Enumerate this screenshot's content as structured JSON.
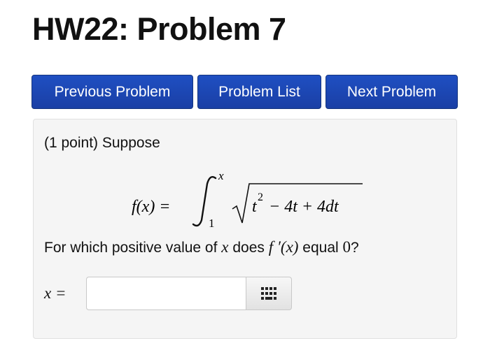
{
  "page": {
    "title": "HW22: Problem 7"
  },
  "nav": {
    "previous_label": "Previous Problem",
    "list_label": "Problem List",
    "next_label": "Next Problem",
    "button_color": "#1f4fc2"
  },
  "problem": {
    "intro": "(1 point) Suppose",
    "formula": {
      "lhs": "f(x) =",
      "upper_limit": "x",
      "lower_limit": "1",
      "t": "t",
      "exponent": "2",
      "rest": "− 4t + 4dt"
    },
    "question": {
      "part1": "For which positive value of",
      "var_x": "x",
      "part2": "does",
      "fprime": "f ′(x)",
      "part3": "equal",
      "zero": "0",
      "end": "?"
    },
    "answer": {
      "label": "x =",
      "value": "",
      "placeholder": "",
      "keypad_icon": "keypad-icon"
    }
  }
}
